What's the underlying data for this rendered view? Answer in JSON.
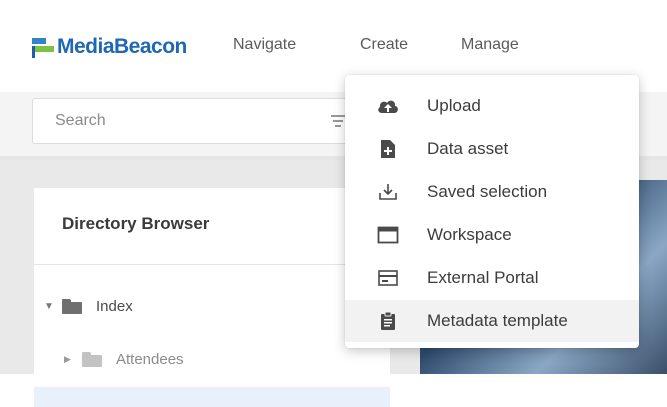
{
  "app": {
    "logo_text": "MediaBeacon",
    "brand_colors": {
      "blue": "#1f69b3",
      "green": "#7cc245"
    }
  },
  "nav": {
    "navigate": "Navigate",
    "create": "Create",
    "manage": "Manage"
  },
  "search": {
    "placeholder": "Search",
    "filter_icon": "filter-icon"
  },
  "directory": {
    "title": "Directory Browser",
    "items": [
      {
        "label": "Index",
        "expanded": true,
        "icon": "folder-icon"
      },
      {
        "label": "Attendees",
        "expanded": false,
        "icon": "folder-icon"
      }
    ]
  },
  "create_menu": {
    "items": [
      {
        "label": "Upload",
        "icon": "cloud-upload-icon"
      },
      {
        "label": "Data asset",
        "icon": "file-add-icon"
      },
      {
        "label": "Saved selection",
        "icon": "download-tray-icon"
      },
      {
        "label": "Workspace",
        "icon": "window-icon"
      },
      {
        "label": "External Portal",
        "icon": "portal-card-icon"
      },
      {
        "label": "Metadata template",
        "icon": "clipboard-icon",
        "highlighted": true
      }
    ]
  }
}
